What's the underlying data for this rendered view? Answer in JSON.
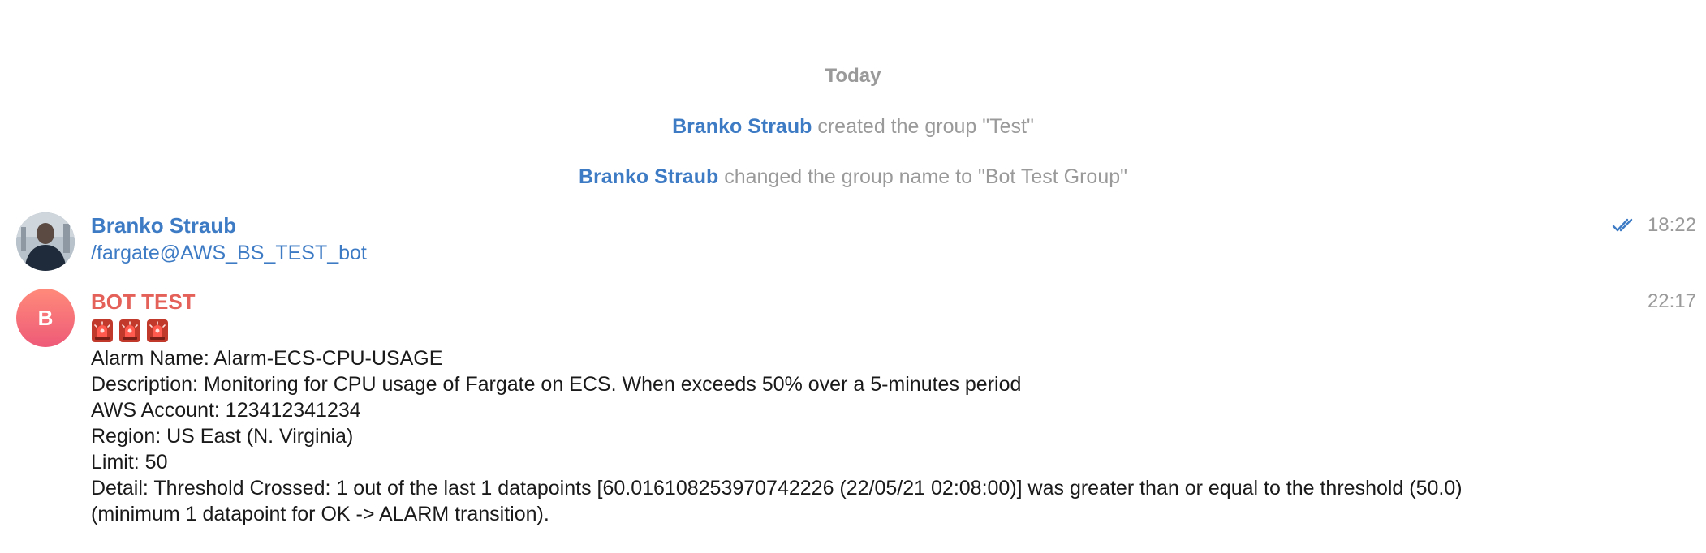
{
  "date_separator": "Today",
  "service_messages": [
    {
      "actor": "Branko Straub",
      "text": "created the group \"Test\""
    },
    {
      "actor": "Branko Straub",
      "text": "changed the group name to \"Bot Test Group\""
    }
  ],
  "messages": [
    {
      "sender": "Branko Straub",
      "time": "18:22",
      "text": "/fargate@AWS_BS_TEST_bot",
      "status_icon": "double-check-icon"
    },
    {
      "sender": "BOT TEST",
      "avatar_letter": "B",
      "time": "22:17",
      "emoji_icons": [
        "siren-icon",
        "siren-icon",
        "siren-icon"
      ],
      "lines": [
        "Alarm Name: Alarm-ECS-CPU-USAGE",
        "Description: Monitoring for CPU usage of Fargate on ECS. When exceeds 50% over a 5-minutes period",
        "AWS Account: 123412341234",
        "Region: US East (N. Virginia)",
        "Limit: 50",
        "Detail: Threshold Crossed: 1 out of the last 1 datapoints [60.016108253970742226 (22/05/21 02:08:00)] was greater than or equal to the threshold (50.0)",
        "(minimum 1 datapoint for OK -> ALARM transition)."
      ]
    }
  ],
  "colors": {
    "link_blue": "#3e7bc5",
    "bot_name_red": "#e4615a",
    "muted_gray": "#9a9a9a"
  }
}
